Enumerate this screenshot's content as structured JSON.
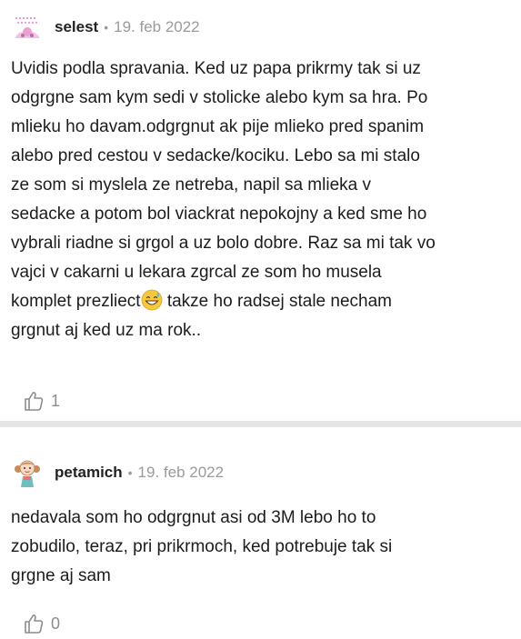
{
  "comments": [
    {
      "username": "selest",
      "separator": "•",
      "date": "19. feb 2022",
      "text_before_emoji": "Uvidis podla spravania. Ked uz papa prikrmy tak si uz\nodgrgne sam kym sedi v stolicke alebo kym sa hra. Po\nmlieku ho davam.odgrgnut ak pije mlieko pred spanim\nalebo pred cestou v sedacke/kociku. Lebo sa mi stalo\nze som si myslela ze netreba, napil sa mlieka v\nsedacke a potom bol viackrat nepokojny a ked sme ho\nvybrali riadne si grgol a uz bolo dobre. Raz sa mi tak vo\nvajci v cakarni u lekara zgrcal ze som ho musela\nkomplet prezliect",
      "text_after_emoji": " takze ho radsej stale necham\ngrgnut aj ked uz ma rok..",
      "likes": "1",
      "avatar": "pink-dotted-avatar",
      "emoji": "grinning-sweat-emoji"
    },
    {
      "username": "petamich",
      "separator": "•",
      "date": "19. feb 2022",
      "text": "nedavala som ho odgrgnut asi od 3M lebo ho to\nzobudilo, teraz, pri prikrmoch, ked potrebuje tak si\ngrgne aj sam",
      "likes": "0",
      "avatar": "girl-avatar"
    }
  ],
  "colors": {
    "divider": "#e6e6e6",
    "meta": "#9a9a9a",
    "text": "#1c1c1c",
    "like_icon": "#8c8c8c"
  }
}
